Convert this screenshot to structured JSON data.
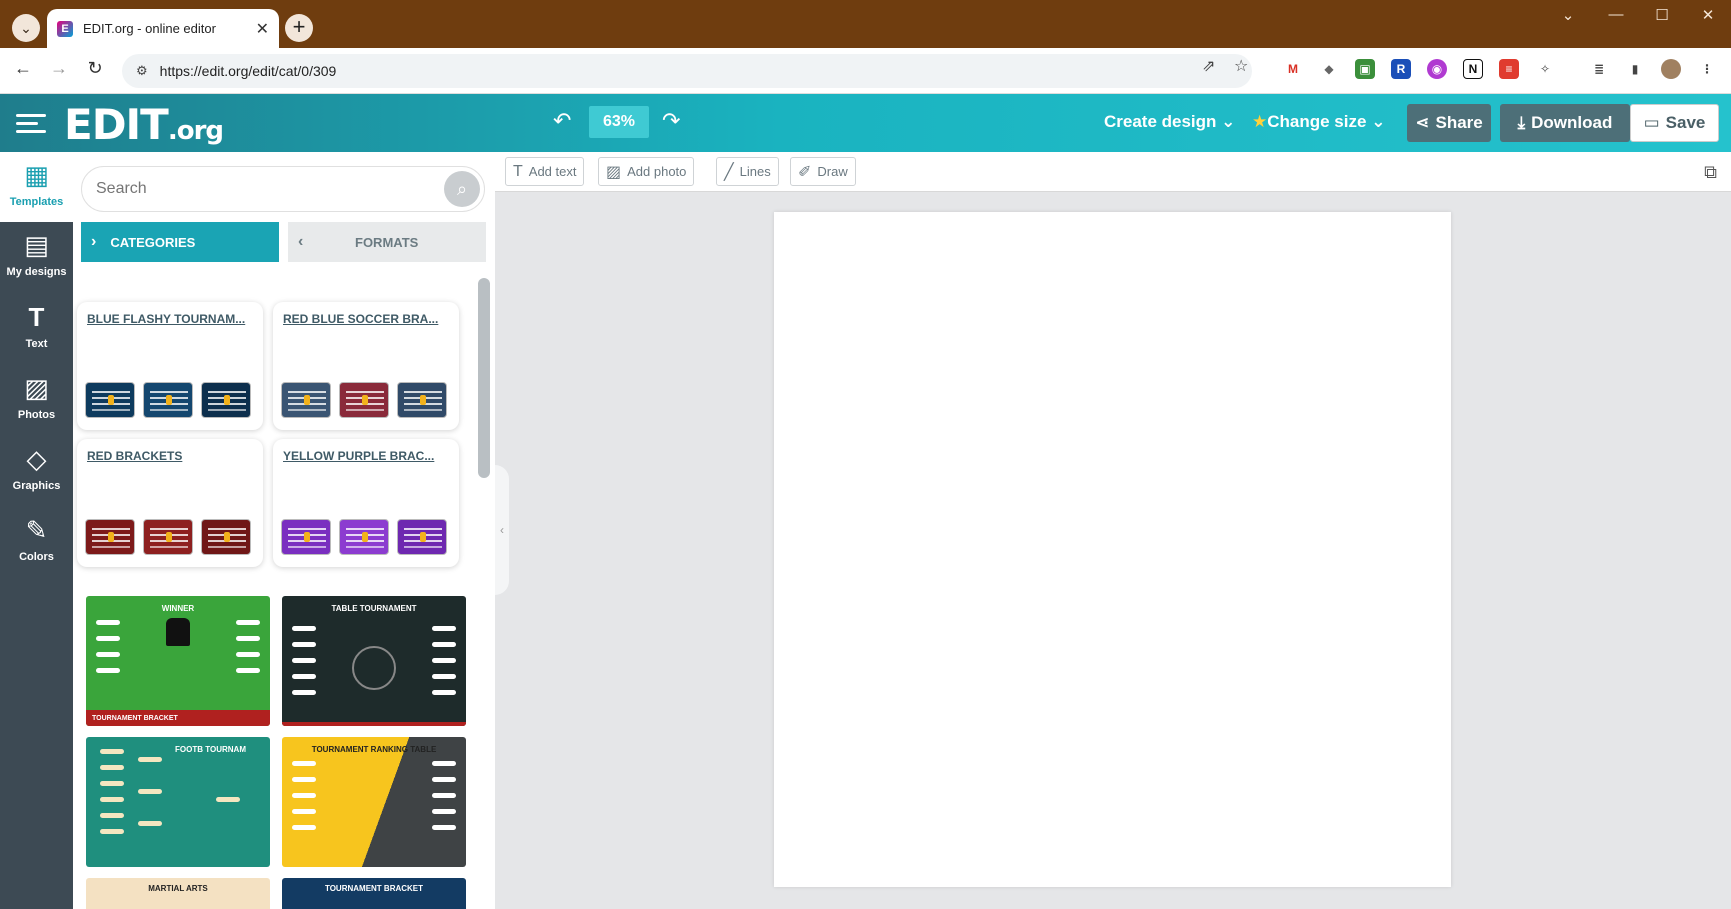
{
  "browser": {
    "tab_title": "EDIT.org - online editor",
    "tab_favicon_letter": "E",
    "url": "https://edit.org/edit/cat/0/309",
    "icons": [
      "tab-search-icon",
      "close-icon",
      "new-tab-icon",
      "back-icon",
      "forward-icon",
      "reload-icon",
      "site-info-icon",
      "share-page-icon",
      "bookmark-star-icon"
    ]
  },
  "app": {
    "logo_main": "EDIT",
    "logo_suffix": ".org",
    "zoom": "63%",
    "create_design": "Create design",
    "change_size": "Change size",
    "share": "Share",
    "download": "Download",
    "save": "Save"
  },
  "rail": [
    {
      "label": "Templates",
      "icon": "templates-icon",
      "active": true
    },
    {
      "label": "My designs",
      "icon": "my-designs-icon"
    },
    {
      "label": "Text",
      "icon": "text-icon"
    },
    {
      "label": "Photos",
      "icon": "photos-icon"
    },
    {
      "label": "Graphics",
      "icon": "graphics-icon"
    },
    {
      "label": "Colors",
      "icon": "colors-icon"
    }
  ],
  "panel": {
    "search_placeholder": "Search",
    "categories_label": "CATEGORIES",
    "formats_label": "FORMATS",
    "category_cards": [
      {
        "title": "BLUE FLASHY TOURNAM...",
        "color": "#0e3b5e"
      },
      {
        "title": "RED BLUE SOCCER BRA...",
        "color": "#3a5573"
      },
      {
        "title": "RED BRACKETS",
        "color": "#7d1a1a"
      },
      {
        "title": "YELLOW PURPLE BRAC...",
        "color": "#7a2fc0"
      }
    ],
    "templates": [
      {
        "head": "WINNER",
        "foot": "TOURNAMENT BRACKET",
        "color": "#3aa53b"
      },
      {
        "head": "TABLE TOURNAMENT",
        "foot": "",
        "color": "#1e2b2b"
      },
      {
        "head": "FOOTB TOURNAM",
        "foot": "",
        "color": "#1f8f7e"
      },
      {
        "head": "TOURNAMENT RANKING TABLE",
        "foot": "",
        "color": "#f7c51e"
      },
      {
        "head": "MARTIAL ARTS",
        "foot": "",
        "color": "#f4e1c2"
      },
      {
        "head": "TOURNAMENT BRACKET",
        "foot": "",
        "color": "#133b63"
      }
    ]
  },
  "toolbar": {
    "add_text": "Add text",
    "add_photo": "Add photo",
    "lines": "Lines",
    "draw": "Draw"
  },
  "colors": {
    "brand_teal": "#1ab3c0",
    "rail_bg": "#3d4a54",
    "browser_frame": "#6f3d0f"
  }
}
